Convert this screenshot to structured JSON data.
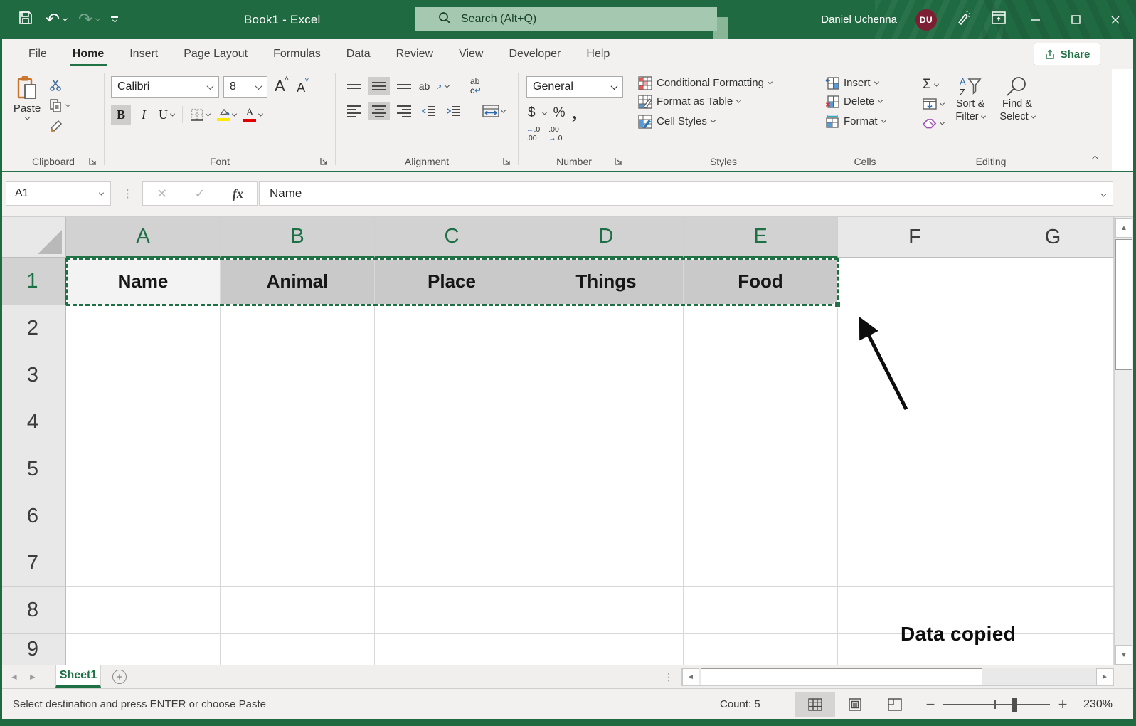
{
  "titlebar": {
    "title": "Book1  -  Excel",
    "search_placeholder": "Search (Alt+Q)",
    "user_name": "Daniel Uchenna",
    "user_initials": "DU"
  },
  "tabs": {
    "items": [
      "File",
      "Home",
      "Insert",
      "Page Layout",
      "Formulas",
      "Data",
      "Review",
      "View",
      "Developer",
      "Help"
    ],
    "active": "Home",
    "share_label": "Share"
  },
  "ribbon": {
    "clipboard": {
      "label": "Clipboard",
      "paste": "Paste"
    },
    "font": {
      "label": "Font",
      "font_name": "Calibri",
      "font_size": "8",
      "bold": "B",
      "italic": "I",
      "underline": "U"
    },
    "alignment": {
      "label": "Alignment"
    },
    "number": {
      "label": "Number",
      "format": "General",
      "currency": "$",
      "percent": "%",
      "comma": ","
    },
    "styles": {
      "label": "Styles",
      "items": [
        "Conditional Formatting",
        "Format as Table",
        "Cell Styles"
      ]
    },
    "cells": {
      "label": "Cells",
      "items": [
        "Insert",
        "Delete",
        "Format"
      ]
    },
    "editing": {
      "label": "Editing",
      "autosum": "Σ",
      "sort_line1": "Sort &",
      "sort_line2": "Filter",
      "find_line1": "Find &",
      "find_line2": "Select"
    }
  },
  "formula_bar": {
    "name_box": "A1",
    "fx": "fx",
    "value": "Name"
  },
  "grid": {
    "columns": [
      "A",
      "B",
      "C",
      "D",
      "E",
      "F",
      "G"
    ],
    "selected_columns": [
      "A",
      "B",
      "C",
      "D",
      "E"
    ],
    "rows": [
      "1",
      "2",
      "3",
      "4",
      "5",
      "6",
      "7",
      "8",
      "9"
    ],
    "selected_row": "1",
    "active_cell": "A1",
    "row1_values": [
      "Name",
      "Animal",
      "Place",
      "Things",
      "Food"
    ]
  },
  "annotation": {
    "text": "Data copied"
  },
  "sheet_bar": {
    "sheet_name": "Sheet1"
  },
  "status_bar": {
    "message": "Select destination and press ENTER or choose Paste",
    "count": "Count: 5",
    "zoom": "230%"
  },
  "colors": {
    "accent_green": "#217346",
    "titlebar_green": "#1f6a41",
    "avatar_red": "#7d1f32",
    "selection_gray": "#c9c9c9",
    "fill_yellow": "#ffe900",
    "font_red": "#e00000"
  }
}
